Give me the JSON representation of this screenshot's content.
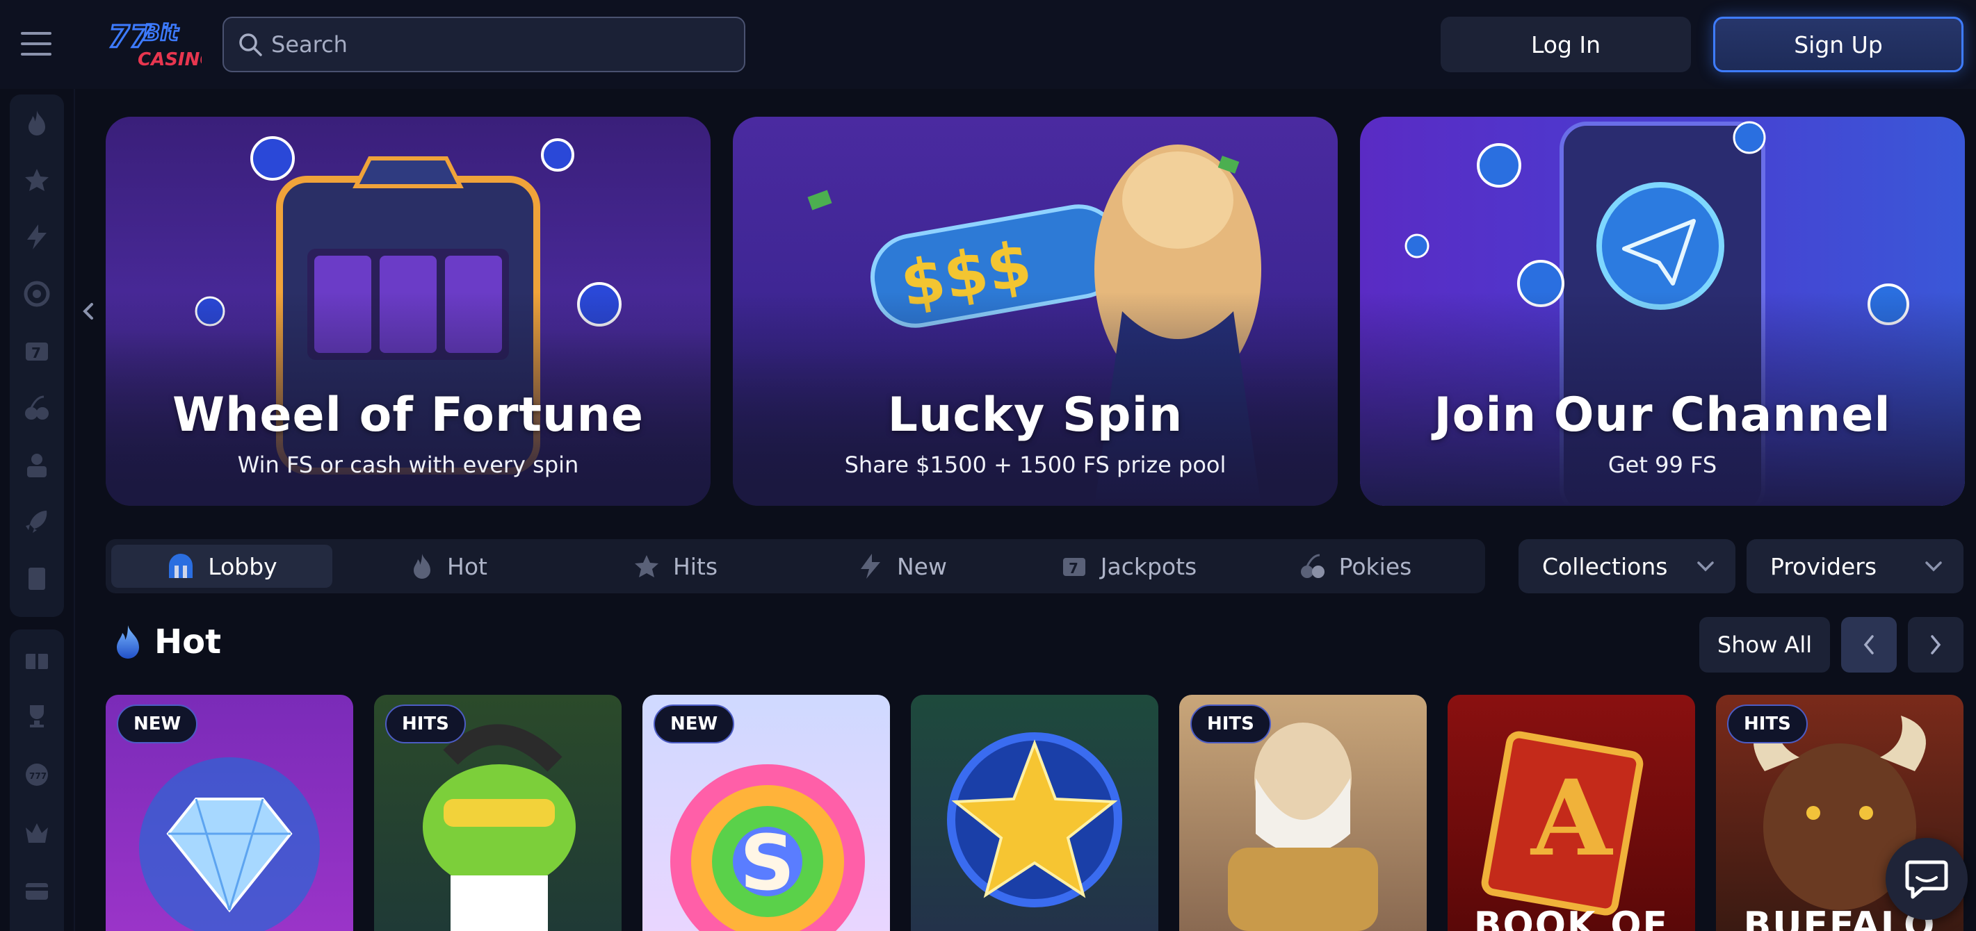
{
  "header": {
    "search_placeholder": "Search",
    "login_label": "Log In",
    "signup_label": "Sign Up"
  },
  "banners": [
    {
      "title": "Wheel of Fortune",
      "subtitle": "Win FS or cash with every spin"
    },
    {
      "title": "Lucky Spin",
      "subtitle": "Share $1500 + 1500 FS prize pool"
    },
    {
      "title": "Join Our Channel",
      "subtitle": "Get 99 FS"
    }
  ],
  "tabs": [
    {
      "label": "Lobby",
      "icon": "lobby-icon"
    },
    {
      "label": "Hot",
      "icon": "fire-icon"
    },
    {
      "label": "Hits",
      "icon": "stars-icon"
    },
    {
      "label": "New",
      "icon": "lightning-icon"
    },
    {
      "label": "Jackpots",
      "icon": "jackpot-icon"
    },
    {
      "label": "Pokies",
      "icon": "cherry-icon"
    }
  ],
  "dropdowns": {
    "collections": "Collections",
    "providers": "Providers"
  },
  "section": {
    "title": "Hot",
    "show_all": "Show All"
  },
  "games": [
    {
      "badge": "NEW",
      "art_text": ""
    },
    {
      "badge": "HITS",
      "art_text": ""
    },
    {
      "badge": "NEW",
      "art_text": ""
    },
    {
      "badge": "",
      "art_text": ""
    },
    {
      "badge": "HITS",
      "art_text": ""
    },
    {
      "badge": "",
      "art_text": "BOOK OF"
    },
    {
      "badge": "HITS",
      "art_text": "BUFFALO"
    }
  ],
  "colors": {
    "background": "#0b0e1a",
    "accent": "#3e7cff",
    "panel": "#1c2236"
  }
}
